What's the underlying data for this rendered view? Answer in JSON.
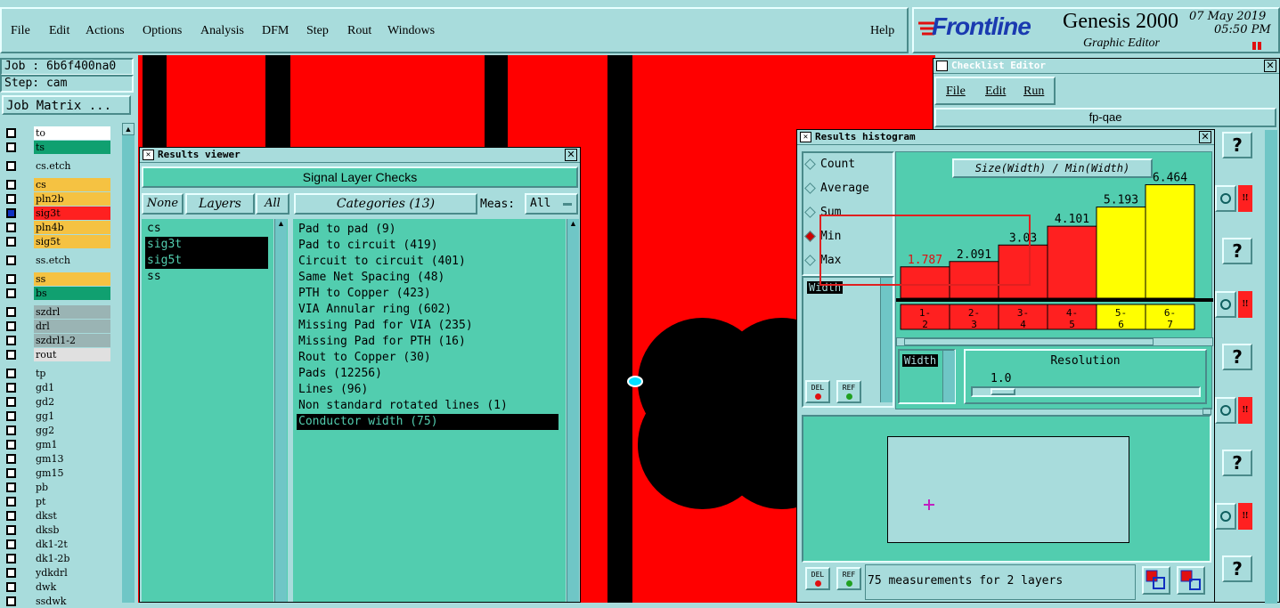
{
  "menubar": {
    "items": [
      {
        "label": "File"
      },
      {
        "label": "Edit"
      },
      {
        "label": "Actions"
      },
      {
        "label": "Options"
      },
      {
        "label": "Analysis"
      },
      {
        "label": "DFM"
      },
      {
        "label": "Step"
      },
      {
        "label": "Rout"
      },
      {
        "label": "Windows"
      }
    ],
    "help": "Help"
  },
  "brand": {
    "logo": "Frontline",
    "product": "Genesis 2000",
    "subtitle": "Graphic Editor",
    "date": "07 May 2019",
    "time": "05:50 PM"
  },
  "job": {
    "job_label": "Job : 6b6f400na0",
    "step_label": "Step: cam",
    "matrix_button": "Job Matrix ..."
  },
  "layers": [
    {
      "name": "to",
      "color": "#ffffff"
    },
    {
      "name": "ts",
      "color": "#10a070"
    },
    {
      "name": "cs.etch",
      "color": "#a8dcdc"
    },
    {
      "name": "cs",
      "color": "#f5c242"
    },
    {
      "name": "pln2b",
      "color": "#f5c242"
    },
    {
      "name": "sig3t",
      "color": "#ff2020"
    },
    {
      "name": "pln4b",
      "color": "#f5c242"
    },
    {
      "name": "sig5t",
      "color": "#f5c242"
    },
    {
      "name": "ss.etch",
      "color": "#a8dcdc"
    },
    {
      "name": "ss",
      "color": "#f5c242"
    },
    {
      "name": "bs",
      "color": "#10a070"
    },
    {
      "name": "szdrl",
      "color": "#9ab4b4"
    },
    {
      "name": "drl",
      "color": "#9ab4b4"
    },
    {
      "name": "szdrl1-2",
      "color": "#9ab4b4"
    },
    {
      "name": "rout",
      "color": "#e0e0e0"
    },
    {
      "name": "tp",
      "color": "#a8dcdc"
    },
    {
      "name": "gd1",
      "color": "#a8dcdc"
    },
    {
      "name": "gd2",
      "color": "#a8dcdc"
    },
    {
      "name": "gg1",
      "color": "#a8dcdc"
    },
    {
      "name": "gg2",
      "color": "#a8dcdc"
    },
    {
      "name": "gm1",
      "color": "#a8dcdc"
    },
    {
      "name": "gm13",
      "color": "#a8dcdc"
    },
    {
      "name": "gm15",
      "color": "#a8dcdc"
    },
    {
      "name": "pb",
      "color": "#a8dcdc"
    },
    {
      "name": "pt",
      "color": "#a8dcdc"
    },
    {
      "name": "dkst",
      "color": "#a8dcdc"
    },
    {
      "name": "dksb",
      "color": "#a8dcdc"
    },
    {
      "name": "dk1-2t",
      "color": "#a8dcdc"
    },
    {
      "name": "dk1-2b",
      "color": "#a8dcdc"
    },
    {
      "name": "ydkdrl",
      "color": "#a8dcdc"
    },
    {
      "name": "dwk",
      "color": "#a8dcdc"
    },
    {
      "name": "ssdwk",
      "color": "#a8dcdc"
    }
  ],
  "results_viewer": {
    "title": "Results viewer",
    "header": "Signal Layer Checks",
    "none_btn": "None",
    "layers_btn": "Layers",
    "all_btn": "All",
    "categories_btn": "Categories (13)",
    "meas_label": "Meas:",
    "meas_value": "All",
    "layer_list": [
      "cs",
      "sig3t",
      "sig5t",
      "ss"
    ],
    "categories": [
      "Pad to pad (9)",
      "Pad to circuit (419)",
      "Circuit to circuit (401)",
      "Same Net Spacing (48)",
      "PTH to Copper (423)",
      "VIA Annular ring (602)",
      "Missing Pad for VIA (235)",
      "Missing Pad for PTH (16)",
      "Rout to Copper (30)",
      "Pads (12256)",
      "Lines (96)",
      "Non standard rotated lines (1)",
      "Conductor width (75)"
    ]
  },
  "checklist": {
    "title": "Checklist Editor",
    "menu": [
      "File",
      "Edit",
      "Run"
    ],
    "name": "fp-qae"
  },
  "histogram": {
    "title": "Results histogram",
    "modes": [
      "Count",
      "Average",
      "Sum",
      "Min",
      "Max"
    ],
    "selected_mode": "Min",
    "chart_title": "Size(Width) / Min(Width)",
    "param": "Width",
    "resolution_label": "Resolution",
    "resolution_value": "1.0",
    "del_label": "DEL",
    "ref_label": "REF",
    "status": "75 measurements for 2 layers",
    "bins": [
      {
        "label": "1-\n2",
        "value": 1.787,
        "text": "1.787",
        "color": "#ff2020"
      },
      {
        "label": "2-\n3",
        "value": 2.091,
        "text": "2.091",
        "color": "#ff2020"
      },
      {
        "label": "3-\n4",
        "value": 3.03,
        "text": "3.03",
        "color": "#ff2020"
      },
      {
        "label": "4-\n5",
        "value": 4.101,
        "text": "4.101",
        "color": "#ff2020"
      },
      {
        "label": "5-\n6",
        "value": 5.193,
        "text": "5.193",
        "color": "#ffff00"
      },
      {
        "label": "6-\n7",
        "value": 6.464,
        "text": "6.464",
        "color": "#ffff00"
      }
    ]
  },
  "side_buttons": {
    "q": "?",
    "bang": "!!"
  }
}
